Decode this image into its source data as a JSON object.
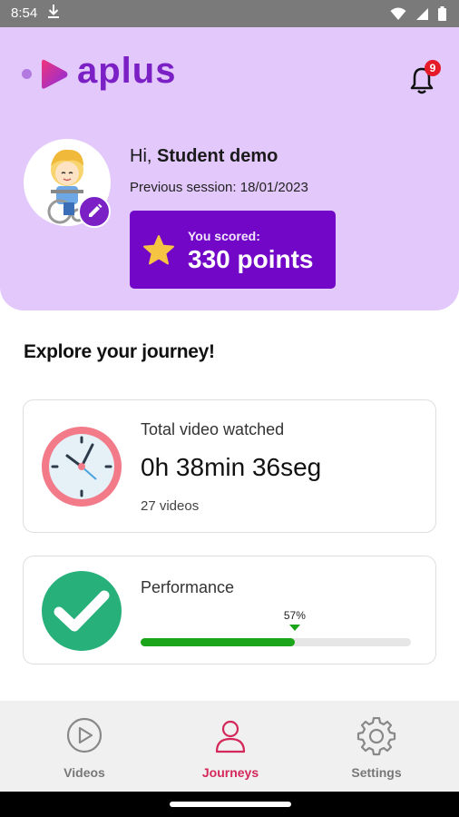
{
  "status_bar": {
    "time": "8:54"
  },
  "brand": {
    "name": "aplus",
    "accent": "#7b20c5"
  },
  "notifications": {
    "count": "9"
  },
  "profile": {
    "greeting_prefix": "Hi, ",
    "user_name": "Student demo",
    "previous_session": "Previous session: 18/01/2023"
  },
  "score": {
    "label": "You scored:",
    "value": "330 points"
  },
  "journey": {
    "title": "Explore your journey!",
    "watch_card": {
      "label": "Total video watched",
      "duration": "0h 38min 36seg",
      "videos": "27 videos"
    },
    "performance_card": {
      "label": "Performance",
      "percent_text": "57%",
      "percent": 57
    }
  },
  "nav": {
    "items": [
      {
        "label": "Videos",
        "icon": "play-circle-icon",
        "active": false
      },
      {
        "label": "Journeys",
        "icon": "person-icon",
        "active": true
      },
      {
        "label": "Settings",
        "icon": "gear-icon",
        "active": false
      }
    ]
  }
}
